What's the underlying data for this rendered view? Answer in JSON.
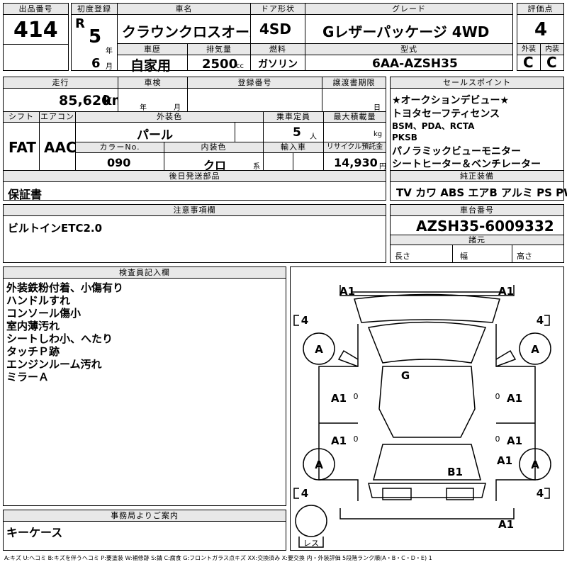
{
  "header": {
    "lot_label": "出品番号",
    "lot": "414",
    "reg_label": "初度登録",
    "era": "R",
    "year": "5",
    "year_unit": "年",
    "month": "6",
    "month_unit": "月",
    "name_label": "車名",
    "name": "クラウンクロスオーバー",
    "door_label": "ドア形状",
    "door": "4SD",
    "grade_label": "グレード",
    "grade": "Gレザーパッケージ 4WD",
    "score_label": "評価点",
    "score": "4",
    "history_label": "車歴",
    "history": "自家用",
    "cc_label": "排気量",
    "cc": "2500",
    "cc_unit": "cc",
    "fuel_label": "燃料",
    "fuel": "ガソリン",
    "model_label": "型式",
    "model": "6AA-AZSH35",
    "ext_label": "外装",
    "ext": "C",
    "int_label": "内装",
    "int": "C"
  },
  "info": {
    "mileage_label": "走行",
    "mileage": "85,620",
    "mileage_unit": "km",
    "inspection_label": "車検",
    "year_unit": "年",
    "month_unit": "月",
    "regno_label": "登録番号",
    "transfer_label": "譲渡書期限",
    "day_unit": "日",
    "shift_label": "シフト",
    "shift": "FAT",
    "ac_label": "エアコン",
    "ac": "AAC",
    "color_label": "外装色",
    "color": "パール",
    "capacity_label": "乗車定員",
    "capacity": "5",
    "capacity_unit": "人",
    "load_label": "最大積載量",
    "load_unit": "kg",
    "colorno_label": "カラーNo.",
    "colorno": "090",
    "intcolor_label": "内装色",
    "intcolor": "クロ",
    "intcolor_unit": "系",
    "import_label": "輸入車",
    "recycle_label": "リサイクル預託金",
    "recycle": "14,930",
    "recycle_unit": "円",
    "later_label": "後日発送部品",
    "later": "保証書"
  },
  "selling": {
    "label": "セールスポイント",
    "lines": [
      "★オークションデビュー★",
      "トヨタセーフティセンス",
      "BSM、PDA、RCTA",
      "PKSB",
      "パノラミックビューモニター",
      "シートヒーター＆ベンチレーター"
    ]
  },
  "equip": {
    "label": "純正装備",
    "items": "TV カワ ABS エアB アルミ PS PW"
  },
  "notes": {
    "label": "注意事項欄",
    "text": "ビルトインETC2.0"
  },
  "chassis": {
    "label": "車台番号",
    "number": "AZSH35-6009332",
    "dim_label": "諸元",
    "length": "長さ",
    "width": "幅",
    "height": "高さ"
  },
  "inspector": {
    "label": "検査員記入欄",
    "lines": [
      "外装鉄粉付着、小傷有り",
      "ハンドルすれ",
      "コンソール傷小",
      "室内薄汚れ",
      "シートしわ小、へたり",
      "タッチＰ跡",
      "エンジンルーム汚れ",
      "ミラーＡ"
    ]
  },
  "office": {
    "label": "事務局よりご案内",
    "text": "キーケース"
  },
  "diagram": {
    "marks": {
      "a1": "A1",
      "a": "A",
      "g": "G",
      "b1": "B1",
      "four": "4",
      "zero": "0"
    },
    "spare": "レス"
  },
  "legend": "A:キズ U:ヘコミ B:キズを伴うヘコミ P:要塗装 W:補修跡 S:錆 C:腐食 G:フロントガラス点キズ XX:交換済み X:要交換 内・外装評価 5段階ランク順(A・B・C・D・E) 1"
}
